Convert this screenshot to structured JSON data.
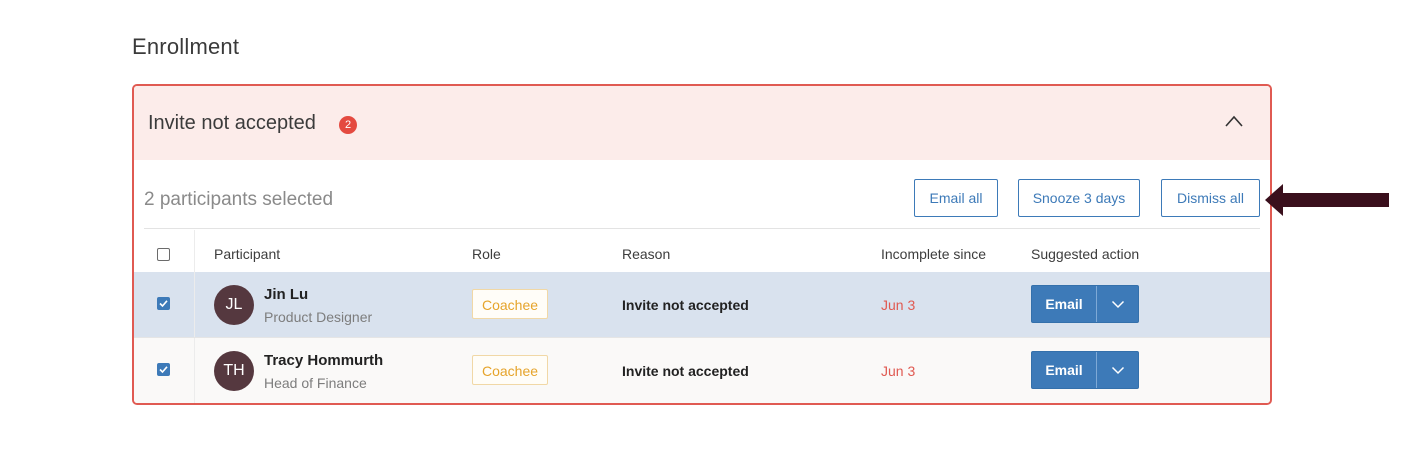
{
  "page": {
    "title": "Enrollment"
  },
  "panel": {
    "title": "Invite not accepted",
    "count": "2",
    "selected_text": "2 participants selected",
    "actions": {
      "email_all": "Email all",
      "snooze": "Snooze 3 days",
      "dismiss": "Dismiss all"
    }
  },
  "table": {
    "columns": {
      "participant": "Participant",
      "role": "Role",
      "reason": "Reason",
      "since": "Incomplete since",
      "action": "Suggested action"
    },
    "rows": [
      {
        "initials": "JL",
        "name": "Jin Lu",
        "title": "Product Designer",
        "role": "Coachee",
        "reason": "Invite not accepted",
        "since": "Jun 3",
        "action": "Email",
        "checked": true
      },
      {
        "initials": "TH",
        "name": "Tracy Hommurth",
        "title": "Head of Finance",
        "role": "Coachee",
        "reason": "Invite not accepted",
        "since": "Jun 3",
        "action": "Email",
        "checked": true
      }
    ]
  },
  "colors": {
    "accent": "#3d7ab8",
    "alert": "#e05a52",
    "alert_bg": "#fcecea",
    "avatar": "#55383f",
    "role_tag": "#e6a42b",
    "annotation_arrow": "#3a0f1c"
  },
  "icons": {
    "collapse": "chevron-up-icon",
    "dropdown": "chevron-down-icon",
    "check": "checkmark-icon",
    "annotation": "arrow-left-icon"
  }
}
